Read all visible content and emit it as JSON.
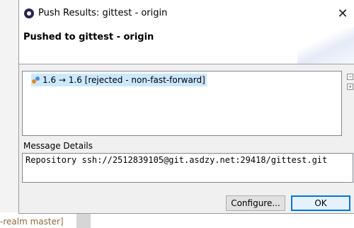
{
  "background": {
    "editor_text": "-realm master]"
  },
  "dialog": {
    "title": "Push Results: gittest - origin",
    "header_title": "Pushed to gittest - origin",
    "results": [
      {
        "label": "1.6 → 1.6 [rejected - non-fast-forward]",
        "selected": true
      }
    ],
    "message_label": "Message Details",
    "message_text": "Repository ssh://2512839105@git.asdzy.net:29418/gittest.git",
    "buttons": {
      "configure": "Configure...",
      "ok": "OK"
    },
    "colors": {
      "selection": "#cce8ff",
      "ok_border": "#0078d7"
    },
    "icons": {
      "title": "eclipse-icon",
      "close": "close-icon",
      "result": "push-ref-icon",
      "collapse": "collapse-all-icon",
      "expand": "expand-all-icon"
    }
  }
}
